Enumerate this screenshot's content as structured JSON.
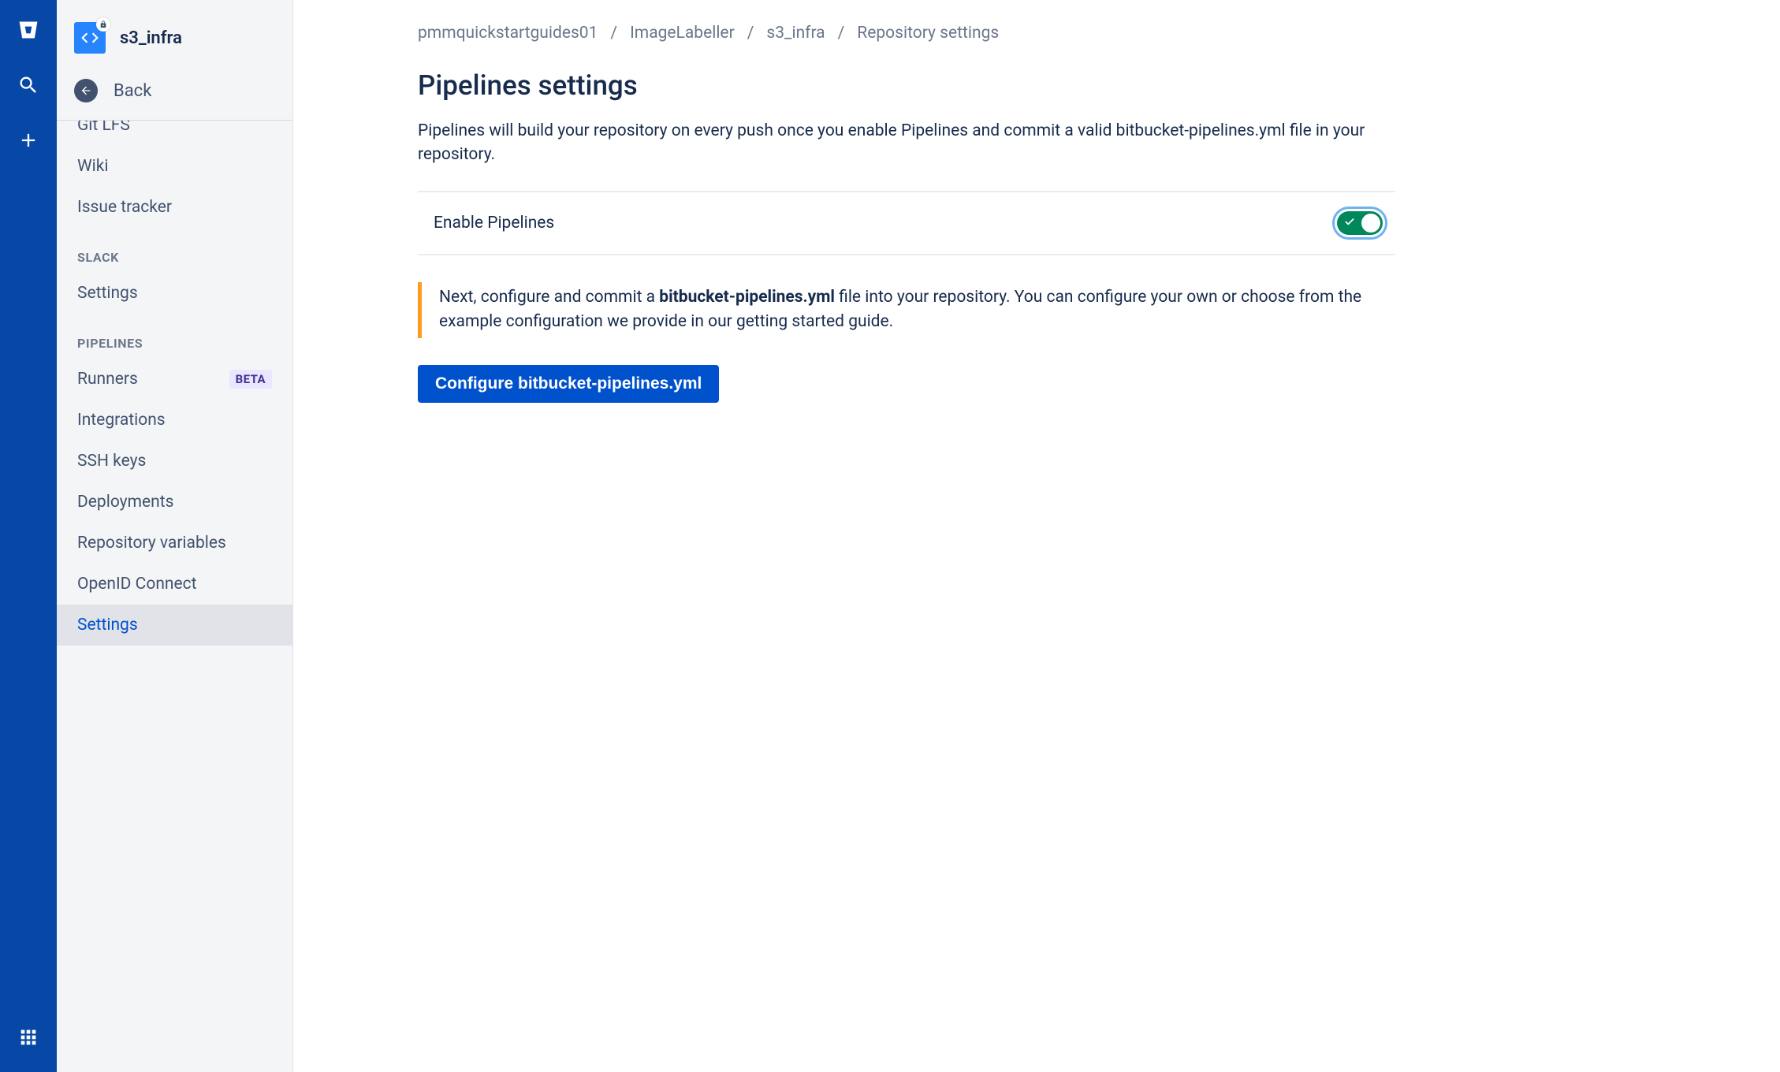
{
  "repo": {
    "name": "s3_infra"
  },
  "back": {
    "label": "Back"
  },
  "sidebar": {
    "top_items": [
      {
        "label": "Git LFS"
      },
      {
        "label": "Wiki"
      },
      {
        "label": "Issue tracker"
      }
    ],
    "groups": [
      {
        "title": "SLACK",
        "items": [
          {
            "label": "Settings"
          }
        ]
      },
      {
        "title": "PIPELINES",
        "items": [
          {
            "label": "Runners",
            "badge": "BETA"
          },
          {
            "label": "Integrations"
          },
          {
            "label": "SSH keys"
          },
          {
            "label": "Deployments"
          },
          {
            "label": "Repository variables"
          },
          {
            "label": "OpenID Connect"
          },
          {
            "label": "Settings",
            "selected": true
          }
        ]
      }
    ]
  },
  "breadcrumbs": [
    {
      "label": "pmmquickstartguides01"
    },
    {
      "label": "ImageLabeller"
    },
    {
      "label": "s3_infra"
    },
    {
      "label": "Repository settings"
    }
  ],
  "page": {
    "title": "Pipelines settings",
    "description": "Pipelines will build your repository on every push once you enable Pipelines and commit a valid bitbucket-pipelines.yml file in your repository.",
    "enable_label": "Enable Pipelines",
    "enable_toggle_on": true,
    "banner_prefix": "Next, configure and commit a ",
    "banner_bold": "bitbucket-pipelines.yml",
    "banner_suffix": " file into your repository. You can configure your own or choose from the example configuration we provide in our getting started guide.",
    "configure_button": "Configure bitbucket-pipelines.yml"
  },
  "colors": {
    "brand_blue": "#0747A6",
    "link_blue": "#0052CC",
    "toggle_green": "#00875A",
    "warning_orange": "#FF991F"
  }
}
